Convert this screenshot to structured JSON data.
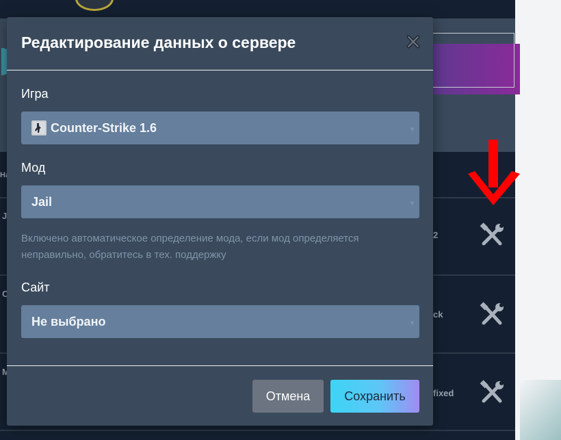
{
  "modal": {
    "title": "Редактирование данных о сервере",
    "close_icon": "close-icon",
    "game": {
      "label": "Игра",
      "value": "Counter-Strike 1.6",
      "icon": "counter-strike-icon"
    },
    "mod": {
      "label": "Мод",
      "value": "Jail"
    },
    "hint": "Включено автоматическое определение мода, если мод определяется неправильно, обратитесь в тех. поддержку",
    "site": {
      "label": "Сайт",
      "value": "Не выбрано"
    },
    "cancel_label": "Отмена",
    "save_label": "Сохранить"
  },
  "background": {
    "header_fragment": "На",
    "rows": [
      {
        "name_fragment": "J",
        "status_fragment": "2",
        "action_icon": "tools-icon"
      },
      {
        "name_fragment": "C",
        "status_fragment": "ck",
        "action_icon": "tools-icon"
      },
      {
        "name_fragment": "M",
        "status_fragment": "fixed",
        "action_icon": "tools-icon"
      }
    ],
    "arrow_icon": "red-down-arrow-icon",
    "accent_red": "#ff0000"
  }
}
